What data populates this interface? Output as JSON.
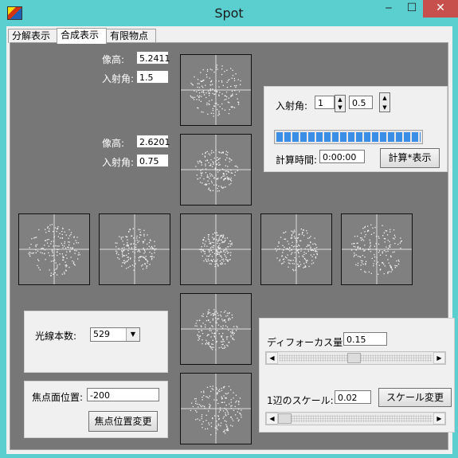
{
  "window": {
    "title": "Spot",
    "minimize": "‒",
    "maximize": "☐",
    "close": "✕"
  },
  "tabs": [
    {
      "label": "分解表示",
      "active": false
    },
    {
      "label": "合成表示",
      "active": true
    },
    {
      "label": "有限物点",
      "active": false
    }
  ],
  "object_points": [
    {
      "height_label": "像高:",
      "height_value": "5.2411",
      "angle_label": "入射角:",
      "angle_value": "1.5"
    },
    {
      "height_label": "像高:",
      "height_value": "2.6201",
      "angle_label": "入射角:",
      "angle_value": "0.75"
    }
  ],
  "calc_group": {
    "angle_label": "入射角:",
    "angle_value_1": "1",
    "angle_value_2": "0.5",
    "progress": 1.0,
    "time_label": "計算時間:",
    "time_value": "0:00:00",
    "calc_button": "計算*表示"
  },
  "ray_group": {
    "label": "光線本数:",
    "selected": "529"
  },
  "focus_group": {
    "label": "焦点面位置:",
    "value": "-200",
    "button": "焦点位置変更"
  },
  "defocus_group": {
    "defocus_label": "ディフォーカス量:",
    "defocus_value": "0.15",
    "defocus_slider": 0.49,
    "scale_label": "1辺のスケール:",
    "scale_value": "0.02",
    "scale_button": "スケール変更",
    "scale_slider": 0.0
  },
  "icons": {
    "minimize": "minimize-icon",
    "maximize": "maximize-icon",
    "close": "close-icon",
    "app": "app-icon"
  }
}
